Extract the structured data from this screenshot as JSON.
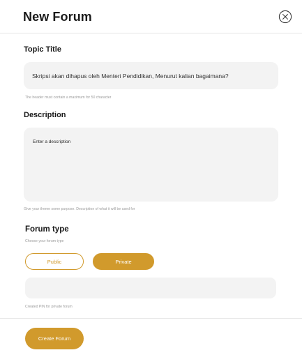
{
  "header": {
    "title": "New Forum",
    "close_icon": "close-circle-icon"
  },
  "topic": {
    "label": "Topic Title",
    "value": "Skripsi akan dihapus oleh Menteri Pendidikan, Menurut kalian bagaimana?",
    "helper": "The header must contain a maximum for 50 character"
  },
  "description": {
    "label": "Description",
    "placeholder": "Enter a description",
    "helper": "Give your theme some purpose. Description of what it will be used for"
  },
  "forum_type": {
    "label": "Forum type",
    "helper": "Choose your forum type",
    "options": [
      "Public",
      "Private"
    ],
    "selected": "Private"
  },
  "pin": {
    "value": "",
    "helper": "Created PIN for private forum"
  },
  "footer": {
    "create_label": "Create Forum"
  },
  "colors": {
    "accent": "#d19a2c",
    "field_bg": "#f3f3f3",
    "divider": "#e6e6e6",
    "helper_text": "#9a9a9a"
  }
}
